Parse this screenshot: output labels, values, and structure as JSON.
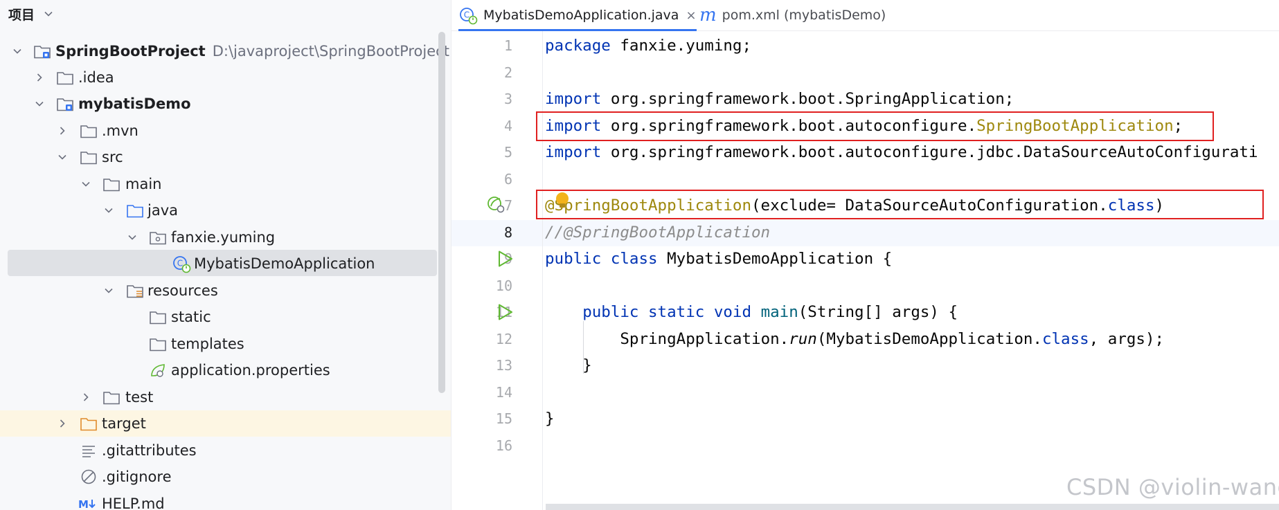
{
  "panel": {
    "title": "项目",
    "tree": [
      {
        "label": "SpringBootProject",
        "path": "D:\\javaproject\\SpringBootProject"
      },
      {
        "label": ".idea"
      },
      {
        "label": "mybatisDemo"
      },
      {
        "label": ".mvn"
      },
      {
        "label": "src"
      },
      {
        "label": "main"
      },
      {
        "label": "java"
      },
      {
        "label": "fanxie.yuming"
      },
      {
        "label": "MybatisDemoApplication"
      },
      {
        "label": "resources"
      },
      {
        "label": "static"
      },
      {
        "label": "templates"
      },
      {
        "label": "application.properties"
      },
      {
        "label": "test"
      },
      {
        "label": "target"
      },
      {
        "label": ".gitattributes"
      },
      {
        "label": ".gitignore"
      },
      {
        "label": "HELP.md"
      }
    ]
  },
  "tabs": [
    {
      "label": "MybatisDemoApplication.java",
      "close": "×",
      "active": true
    },
    {
      "label": "pom.xml (mybatisDemo)",
      "icon_text": "m",
      "active": false
    }
  ],
  "editor": {
    "current_line": 8,
    "line_numbers": [
      "1",
      "2",
      "3",
      "4",
      "5",
      "6",
      "7",
      "8",
      "9",
      "10",
      "11",
      "12",
      "13",
      "14",
      "15",
      "16"
    ],
    "code": {
      "l1": {
        "kw": "package",
        "rest": " fanxie.yuming;"
      },
      "l3": {
        "kw": "import",
        "rest": " org.springframework.boot.SpringApplication;"
      },
      "l4": {
        "kw": "import",
        "pre": " org.springframework.boot.autoconfigure.",
        "ann": "SpringBootApplication",
        "post": ";"
      },
      "l5": {
        "kw": "import",
        "rest": " org.springframework.boot.autoconfigure.jdbc.DataSourceAutoConfigurati"
      },
      "l7": {
        "ann": "@SpringBootApplication",
        "pre": "(exclude= DataSourceAutoConfiguration.",
        "kw": "class",
        "post": ")"
      },
      "l8": {
        "comment": "//@SpringBootApplication"
      },
      "l9": {
        "kw": "public class",
        "rest": " MybatisDemoApplication {"
      },
      "l11": {
        "indent": "    ",
        "kw": "public static void",
        "mth": " main",
        "rest": "(String[] args) {"
      },
      "l12": {
        "indent": "        ",
        "pre": "SpringApplication.",
        "itl": "run",
        "mid": "(MybatisDemoApplication.",
        "kw": "class",
        "post": ", args);"
      },
      "l13": {
        "text": "    }"
      },
      "l15": {
        "text": "}"
      }
    }
  },
  "watermark": "CSDN @violin-wang",
  "colors": {
    "keyword": "#0033b3",
    "annotation": "#9e880d",
    "comment": "#8c8c8c",
    "highlight_box": "#e02020",
    "accent": "#3574f0"
  }
}
